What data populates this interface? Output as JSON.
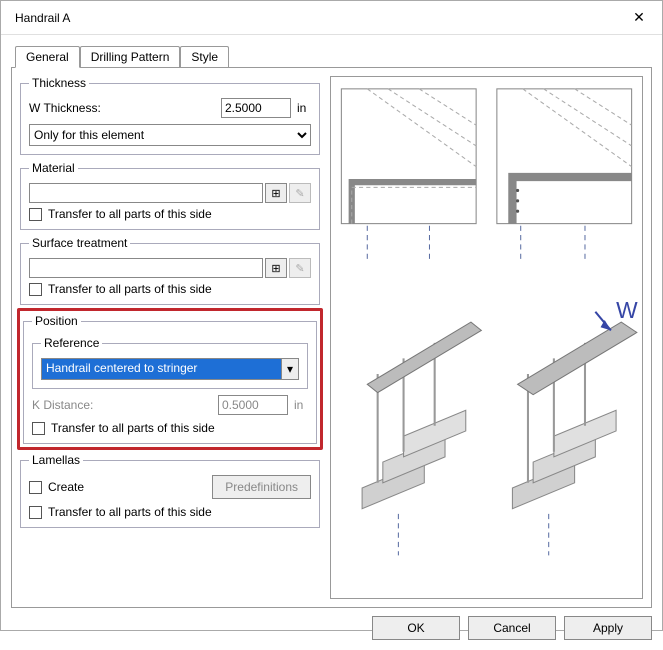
{
  "window": {
    "title": "Handrail A"
  },
  "tabs": {
    "general": "General",
    "drilling": "Drilling Pattern",
    "style": "Style"
  },
  "thickness": {
    "legend": "Thickness",
    "label": "W Thickness:",
    "value": "2.5000",
    "unit": "in",
    "scope": "Only for this element"
  },
  "material": {
    "legend": "Material",
    "value": "",
    "transfer_label": "Transfer to all parts of this side"
  },
  "surface": {
    "legend": "Surface treatment",
    "value": "",
    "transfer_label": "Transfer to all parts of this side"
  },
  "position": {
    "legend": "Position",
    "reference_legend": "Reference",
    "reference_value": "Handrail centered to stringer",
    "k_label": "K Distance:",
    "k_value": "0.5000",
    "k_unit": "in",
    "transfer_label": "Transfer to all parts of this side"
  },
  "lamellas": {
    "legend": "Lamellas",
    "create_label": "Create",
    "predef_label": "Predefinitions",
    "transfer_label": "Transfer to all parts of this side"
  },
  "buttons": {
    "ok": "OK",
    "cancel": "Cancel",
    "apply": "Apply"
  },
  "icons": {
    "browse": "⊞",
    "edit": "✎",
    "dropdown": "▾",
    "close": "✕"
  },
  "preview": {
    "w_label": "W"
  }
}
